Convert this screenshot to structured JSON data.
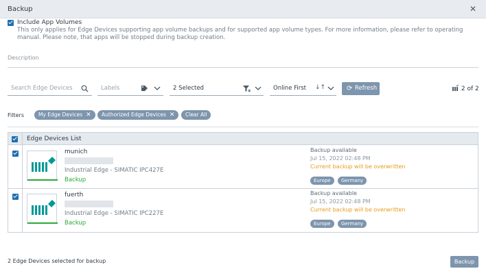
{
  "dialog": {
    "title": "Backup",
    "close_icon": "close-icon"
  },
  "include": {
    "label": "Include App Volumes",
    "checked": true,
    "note": "This only applies for Edge Devices supporting app volume backups and for supported app volume types. For more information, please refer to operating manual. Please note, that apps will be stopped during backup creation."
  },
  "description": {
    "label": "Description",
    "value": ""
  },
  "toolbar": {
    "search_placeholder": "Search Edge Devices",
    "labels_placeholder": "Labels",
    "status_value": "2 Selected",
    "sort_value": "Online First",
    "refresh_label": "Refresh",
    "pager": "2 of 2"
  },
  "filters": {
    "label": "Filters",
    "chips": [
      "My Edge Devices",
      "Authorized Edge Devices"
    ],
    "clear_label": "Clear All"
  },
  "list": {
    "header": "Edge Devices List",
    "header_checked": true,
    "rows": [
      {
        "name": "munich",
        "model": "Industrial Edge - SIMATIC IPC427E",
        "status": "Backup",
        "backup_state": "Backup available",
        "date": "Jul 15, 2022 02:48 PM",
        "warning": "Current backup will be overwritten",
        "tags": [
          "Europe",
          "Germany"
        ],
        "checked": true
      },
      {
        "name": "fuerth",
        "model": "Industrial Edge - SIMATIC IPC227E",
        "status": "Backup",
        "backup_state": "Backup available",
        "date": "Jul 15, 2022 02:48 PM",
        "warning": "Current backup will be overwritten",
        "tags": [
          "Europe",
          "Germany"
        ],
        "checked": true
      }
    ]
  },
  "footer": {
    "summary": "2 Edge Devices selected for backup",
    "backup_label": "Backup"
  },
  "colors": {
    "accent": "#1f6fb2",
    "chip": "#7d95ad",
    "success": "#2aa836",
    "warning": "#e89a19"
  }
}
